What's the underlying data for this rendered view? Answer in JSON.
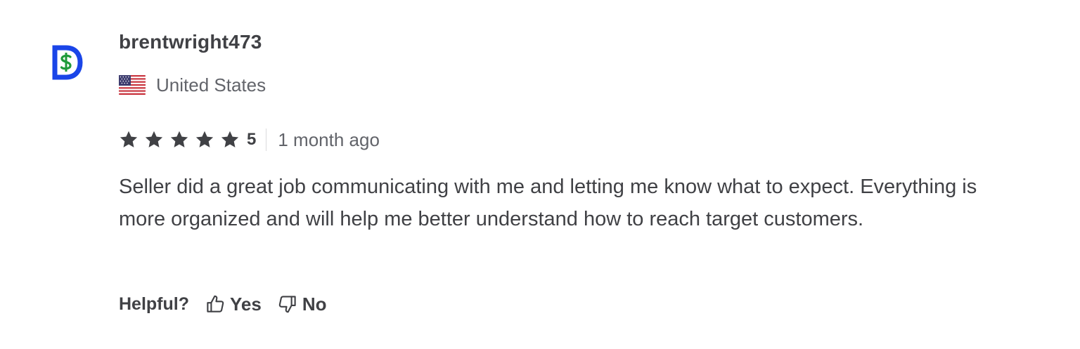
{
  "review": {
    "avatar_icon": "dollar-d-logo-icon",
    "username": "brentwright473",
    "country": "United States",
    "country_flag_icon": "us-flag-icon",
    "rating": {
      "stars": 5,
      "max_stars": 5,
      "value_label": "5"
    },
    "time_ago": "1 month ago",
    "text": "Seller did a great job communicating with me and letting me know what to expect. Everything is more organized and will help me better understand how to reach target customers.",
    "helpful": {
      "label": "Helpful?",
      "yes_label": "Yes",
      "no_label": "No",
      "yes_icon": "thumbs-up-icon",
      "no_icon": "thumbs-down-icon"
    }
  },
  "colors": {
    "text_primary": "#404145",
    "text_secondary": "#62646a",
    "star": "#404145",
    "avatar_blue": "#1a45e8",
    "avatar_green": "#1f9a3a"
  }
}
